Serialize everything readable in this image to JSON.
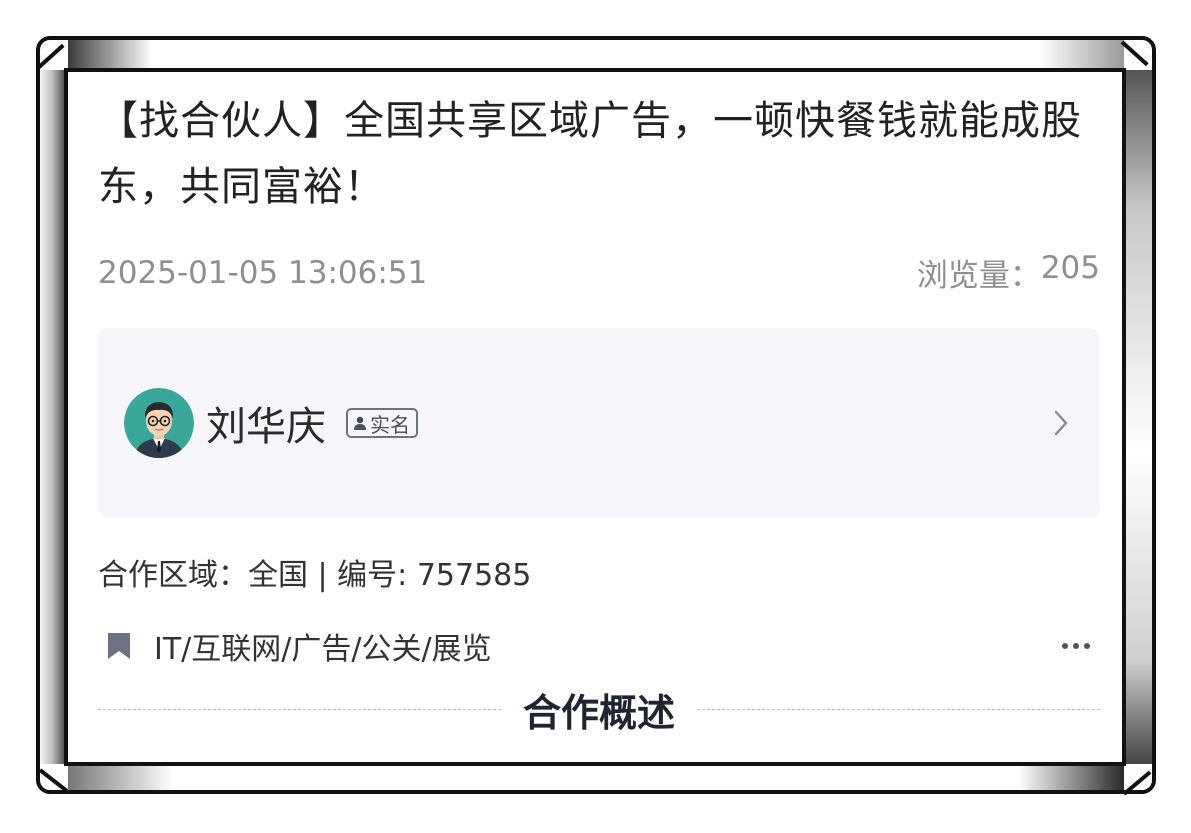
{
  "post": {
    "title": "【找合伙人】全国共享区域广告，一顿快餐钱就能成股东，共同富裕！",
    "datetime": "2025-01-05 13:06:51",
    "views_label": "浏览量：",
    "views_count": "205"
  },
  "author": {
    "name": "刘华庆",
    "badge_label": "实名",
    "avatar_icon": "avatar-man-glasses-icon"
  },
  "details": {
    "region_info": "合作区域：全国 | 编号: 757585",
    "category": "IT/互联网/广告/公关/展览",
    "category_icon": "bookmark-icon"
  },
  "section": {
    "title": "合作概述"
  },
  "colors": {
    "card_bg": "#f6f6fa",
    "meta_gray": "#8e8e93",
    "avatar_bg": "#3aa79a"
  }
}
